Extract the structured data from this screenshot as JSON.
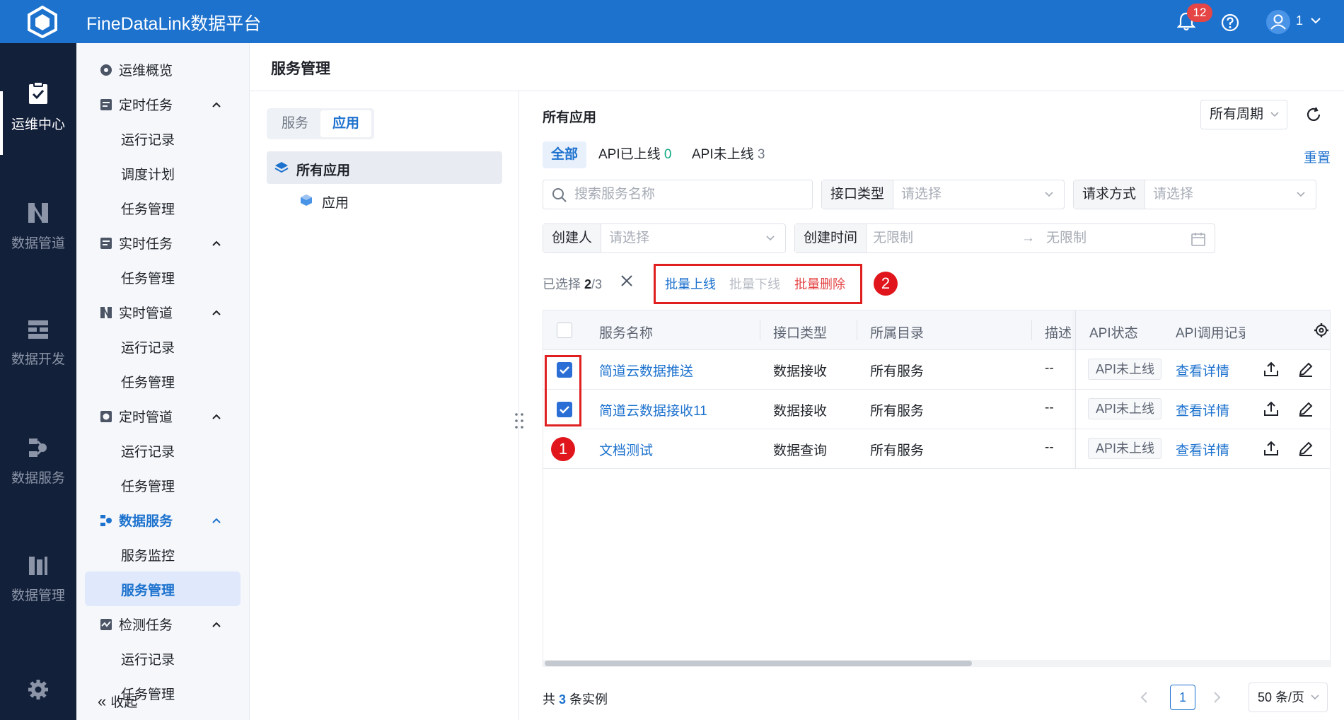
{
  "app": {
    "title": "FineDataLink数据平台",
    "notification_count": "12",
    "user": "1",
    "brand_color": "#1d72ce"
  },
  "rail": [
    {
      "label": "运维中心",
      "icon": "clipboard-check-icon",
      "active": true
    },
    {
      "label": "数据管道",
      "icon": "pipeline-icon"
    },
    {
      "label": "数据开发",
      "icon": "dev-icon"
    },
    {
      "label": "数据服务",
      "icon": "service-icon"
    },
    {
      "label": "数据管理",
      "icon": "manage-icon"
    }
  ],
  "sidebar": {
    "overview": "运维概览",
    "groups": [
      {
        "label": "定时任务",
        "items": [
          "运行记录",
          "调度计划",
          "任务管理"
        ]
      },
      {
        "label": "实时任务",
        "items": [
          "任务管理"
        ]
      },
      {
        "label": "实时管道",
        "items": [
          "运行记录",
          "任务管理"
        ]
      },
      {
        "label": "定时管道",
        "items": [
          "运行记录",
          "任务管理"
        ]
      },
      {
        "label": "数据服务",
        "items": [
          "服务监控",
          "服务管理"
        ],
        "active_item": "服务管理"
      },
      {
        "label": "检测任务",
        "items": [
          "运行记录",
          "任务管理"
        ]
      }
    ],
    "collapse": "收起"
  },
  "page": {
    "title": "服务管理"
  },
  "tree": {
    "seg": [
      "服务",
      "应用"
    ],
    "root": "所有应用",
    "child": "应用"
  },
  "main": {
    "title": "所有应用",
    "period": "所有周期",
    "tabs": {
      "all": "全部",
      "online": "API已上线",
      "online_count": "0",
      "offline": "API未上线",
      "offline_count": "3"
    },
    "reset": "重置",
    "search_placeholder": "搜索服务名称",
    "filter_interface": "接口类型",
    "filter_method": "请求方式",
    "filter_creator": "创建人",
    "filter_time": "创建时间",
    "select_placeholder": "请选择",
    "time_from": "无限制",
    "time_to": "无限制",
    "selected_label": "已选择",
    "selected_count": "2",
    "selected_total": "/3",
    "batch_online": "批量上线",
    "batch_offline": "批量下线",
    "batch_delete": "批量删除",
    "marker1": "1",
    "marker2": "2"
  },
  "table": {
    "headers": [
      "服务名称",
      "接口类型",
      "所属目录",
      "描述",
      "API状态",
      "API调用记录"
    ],
    "rows": [
      {
        "name": "简道云数据推送",
        "type": "数据接收",
        "dir": "所有服务",
        "desc": "--",
        "status": "API未上线",
        "detail": "查看详情",
        "checked": true
      },
      {
        "name": "简道云数据接收11",
        "type": "数据接收",
        "dir": "所有服务",
        "desc": "--",
        "status": "API未上线",
        "detail": "查看详情",
        "checked": true
      },
      {
        "name": "文档测试",
        "type": "数据查询",
        "dir": "所有服务",
        "desc": "--",
        "status": "API未上线",
        "detail": "查看详情",
        "checked": false
      }
    ]
  },
  "footer": {
    "total_prefix": "共",
    "total": "3",
    "total_suffix": "条实例",
    "page": "1",
    "page_size": "50 条/页"
  }
}
